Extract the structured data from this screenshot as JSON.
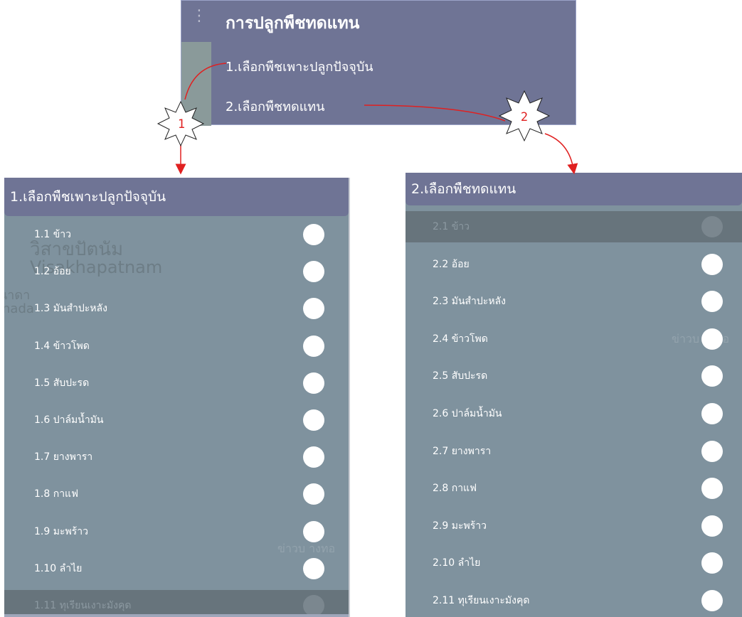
{
  "top_menu": {
    "title": "การปลูกพืชทดแทน",
    "items": [
      {
        "label": "1.เลือกพืชเพาะปลูกปัจจุบัน"
      },
      {
        "label": "2.เลือกพืชทดแทน"
      }
    ]
  },
  "annotations": {
    "badge1": "1",
    "badge2": "2",
    "arrow_color": "#e02020"
  },
  "left_panel": {
    "header": "1.เลือกพืชเพาะปลูกปัจจุบัน",
    "items": [
      {
        "label": "1.1 ข้าว",
        "disabled": false
      },
      {
        "label": "1.2 อ้อย",
        "disabled": false
      },
      {
        "label": "1.3 มันสำปะหลัง",
        "disabled": false
      },
      {
        "label": "1.4 ข้าวโพด",
        "disabled": false
      },
      {
        "label": "1.5 สับปะรด",
        "disabled": false
      },
      {
        "label": "1.6 ปาล์มน้ำมัน",
        "disabled": false
      },
      {
        "label": "1.7 ยางพารา",
        "disabled": false
      },
      {
        "label": "1.8 กาแฟ",
        "disabled": false
      },
      {
        "label": "1.9 มะพร้าว",
        "disabled": false
      },
      {
        "label": "1.10 ลำไย",
        "disabled": false
      },
      {
        "label": "1.11 ทุเรียนเงาะมังคุด",
        "disabled": true
      }
    ],
    "map_labels": {
      "city_th": "วิสาขปัตนัม",
      "city_en": "Visakhapatnam",
      "edge_th": "นาดา",
      "edge_en": "inada",
      "faded": "ข่าวบ างทอ"
    }
  },
  "right_panel": {
    "header": "2.เลือกพืชทดแทน",
    "items": [
      {
        "label": "2.1 ข้าว",
        "disabled": true
      },
      {
        "label": "2.2 อ้อย",
        "disabled": false
      },
      {
        "label": "2.3 มันสำปะหลัง",
        "disabled": false
      },
      {
        "label": "2.4 ข้าวโพด",
        "disabled": false
      },
      {
        "label": "2.5 สับปะรด",
        "disabled": false
      },
      {
        "label": "2.6 ปาล์มน้ำมัน",
        "disabled": false
      },
      {
        "label": "2.7 ยางพารา",
        "disabled": false
      },
      {
        "label": "2.8 กาแฟ",
        "disabled": false
      },
      {
        "label": "2.9 มะพร้าว",
        "disabled": false
      },
      {
        "label": "2.10 ลำไย",
        "disabled": false
      },
      {
        "label": "2.11 ทุเรียนเงาะมังคุด",
        "disabled": false
      }
    ],
    "map_labels": {
      "faded": "ข่าวบ างทอ"
    }
  }
}
